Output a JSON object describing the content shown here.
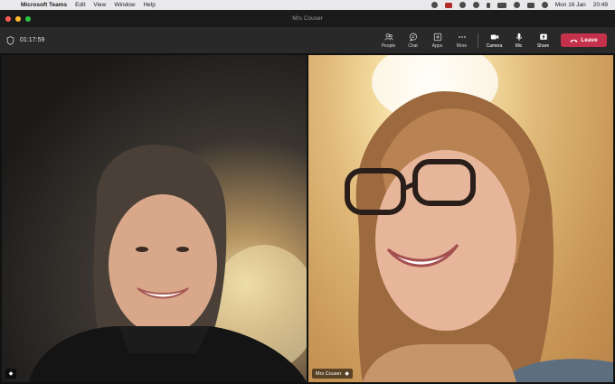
{
  "menubar": {
    "app_name": "Microsoft Teams",
    "menus": [
      "Edit",
      "View",
      "Window",
      "Help"
    ],
    "date": "Mon 16 Jan",
    "time": "20:49"
  },
  "window": {
    "title": "Mrs Couser"
  },
  "controls": {
    "timer": "01:17:59",
    "people_label": "People",
    "chat_label": "Chat",
    "apps_label": "Apps",
    "more_label": "More",
    "camera_label": "Camera",
    "mic_label": "Mic",
    "share_label": "Share",
    "leave_label": "Leave",
    "leave_color": "#c4314b"
  },
  "participants": {
    "left": {
      "name": ""
    },
    "right": {
      "name": "Mrs Couser"
    }
  }
}
